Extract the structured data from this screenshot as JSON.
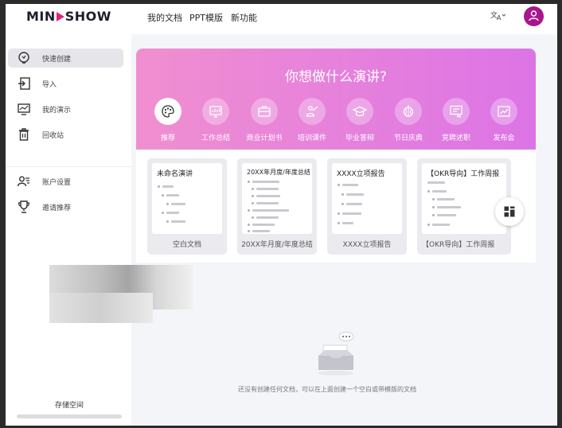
{
  "header": {
    "logo_pre": "MIN",
    "logo_post": "SHOW",
    "nav": [
      {
        "label": "我的文档"
      },
      {
        "label": "PPT模版"
      },
      {
        "label": "新功能"
      }
    ],
    "language_icon": "translate-icon",
    "avatar_icon": "user-icon"
  },
  "sidebar": {
    "items": [
      {
        "label": "快速创建",
        "icon": "idea-icon",
        "active": true
      },
      {
        "label": "导入",
        "icon": "import-icon"
      },
      {
        "label": "我的演示",
        "icon": "presentation-icon"
      },
      {
        "label": "回收站",
        "icon": "trash-icon"
      },
      {
        "label": "账户设置",
        "icon": "account-icon"
      },
      {
        "label": "邀请推荐",
        "icon": "trophy-icon"
      }
    ],
    "storage_label": "存储空间"
  },
  "hero": {
    "title": "你想做什么演讲?",
    "categories": [
      {
        "label": "推荐",
        "icon": "palette-icon",
        "active": true
      },
      {
        "label": "工作总结",
        "icon": "chart-board-icon"
      },
      {
        "label": "商业计划书",
        "icon": "briefcase-icon"
      },
      {
        "label": "培训课件",
        "icon": "teacher-icon"
      },
      {
        "label": "毕业答辩",
        "icon": "graduation-cap-icon"
      },
      {
        "label": "节日庆典",
        "icon": "lantern-icon"
      },
      {
        "label": "竞聘述职",
        "icon": "certificate-icon"
      },
      {
        "label": "发布会",
        "icon": "launch-chart-icon"
      }
    ]
  },
  "templates": [
    {
      "title": "未命名演讲",
      "label": "空白文档"
    },
    {
      "title": "20XX年月度/年度总结",
      "label": "20XX年月度/年度总结"
    },
    {
      "title": "XXXX立项报告",
      "label": "XXXX立项报告"
    },
    {
      "title": "【OKR导向】工作周报",
      "label": "【OKR导向】工作周报"
    }
  ],
  "empty_state": {
    "icon": "empty-inbox-icon",
    "text": "还没有创建任何文档，可以在上面创建一个空白或带模版的文档"
  },
  "colors": {
    "accent": "#a8168d",
    "logo_play": "#e0227b",
    "hero_gradient_start": "#f08fd0",
    "hero_gradient_end": "#dc74e6"
  }
}
